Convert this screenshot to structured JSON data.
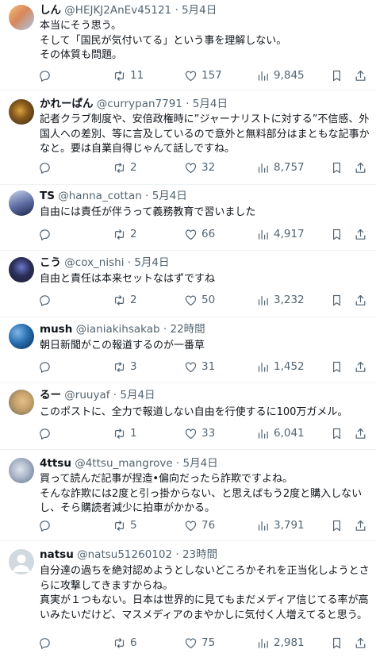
{
  "posts": [
    {
      "name": "しん",
      "handle": "@HEJKJ2AnEv45121",
      "time": "5月4日",
      "text": "本当にそう思う。\nそして「国民が気付いてる」という事を理解しない。\nその体質も問題。",
      "reply_count": "",
      "retweet_count": "11",
      "like_count": "157",
      "view_count": "9,845",
      "avatar_colors": [
        "#f0c27a",
        "#a7c8e8"
      ]
    },
    {
      "name": "かれーぱん",
      "handle": "@currypan7791",
      "time": "5月4日",
      "text": "記者クラブ制度や、安倍政権時に”ジャーナリストに対する”不信感、外国人への差別、等に言及しているので意外と無料部分はまともな記事かなと。要は自業自得じゃんて話しですね。",
      "reply_count": "",
      "retweet_count": "2",
      "like_count": "32",
      "view_count": "8,757",
      "avatar_colors": [
        "#8a5a1c",
        "#2f2a18"
      ]
    },
    {
      "name": "TS",
      "handle": "@hanna_cottan",
      "time": "5月4日",
      "text": "自由には責任が伴うって義務教育で習いました",
      "reply_count": "",
      "retweet_count": "2",
      "like_count": "66",
      "view_count": "4,917",
      "avatar_colors": [
        "#3b4a7a",
        "#c9d3ea"
      ]
    },
    {
      "name": "こう",
      "handle": "@cox_nishi",
      "time": "5月4日",
      "text": "自由と責任は本来セットなはずですね",
      "reply_count": "",
      "retweet_count": "2",
      "like_count": "50",
      "view_count": "3,232",
      "avatar_colors": [
        "#1d1d2e",
        "#6b78c9"
      ]
    },
    {
      "name": "mush",
      "handle": "@ianiakihsakab",
      "time": "22時間",
      "text": "朝日新聞がこの報道するのが一番草",
      "reply_count": "",
      "retweet_count": "3",
      "like_count": "31",
      "view_count": "1,452",
      "avatar_colors": [
        "#2a6fb0",
        "#0c2b55"
      ]
    },
    {
      "name": "るー",
      "handle": "@ruuyaf",
      "time": "5月4日",
      "text": "このポストに、全力で報道しない自由を行使するに100万ガメル。",
      "reply_count": "",
      "retweet_count": "1",
      "like_count": "33",
      "view_count": "6,041",
      "avatar_colors": [
        "#c9a36b",
        "#6d6a5a"
      ]
    },
    {
      "name": "4ttsu",
      "handle": "@4ttsu_mangrove",
      "time": "5月4日",
      "text": "買って読んだ記事が捏造•偏向だったら詐欺ですよね。\nそんな詐欺には2度と引っ掛からない、と思えばもう2度と購入しないし、そら購読者減少に拍車がかかる。",
      "reply_count": "",
      "retweet_count": "5",
      "like_count": "76",
      "view_count": "3,791",
      "avatar_colors": [
        "#aab6c8",
        "#5d6d86"
      ]
    },
    {
      "name": "natsu",
      "handle": "@natsu51260102",
      "time": "23時間",
      "text": "自分達の過ちを絶対認めようとしないどころかそれを正当化しようとさらに攻撃してきますからね。\n真実が１つもない。日本は世界的に見てもまだメディア信じてる率が高いみたいだけど、マスメディアのまやかしに気付く人増えてると思う。",
      "reply_count": "",
      "retweet_count": "6",
      "like_count": "75",
      "view_count": "2,981",
      "avatar_colors": [
        "#cfd9de",
        "#ffffff"
      ]
    }
  ]
}
